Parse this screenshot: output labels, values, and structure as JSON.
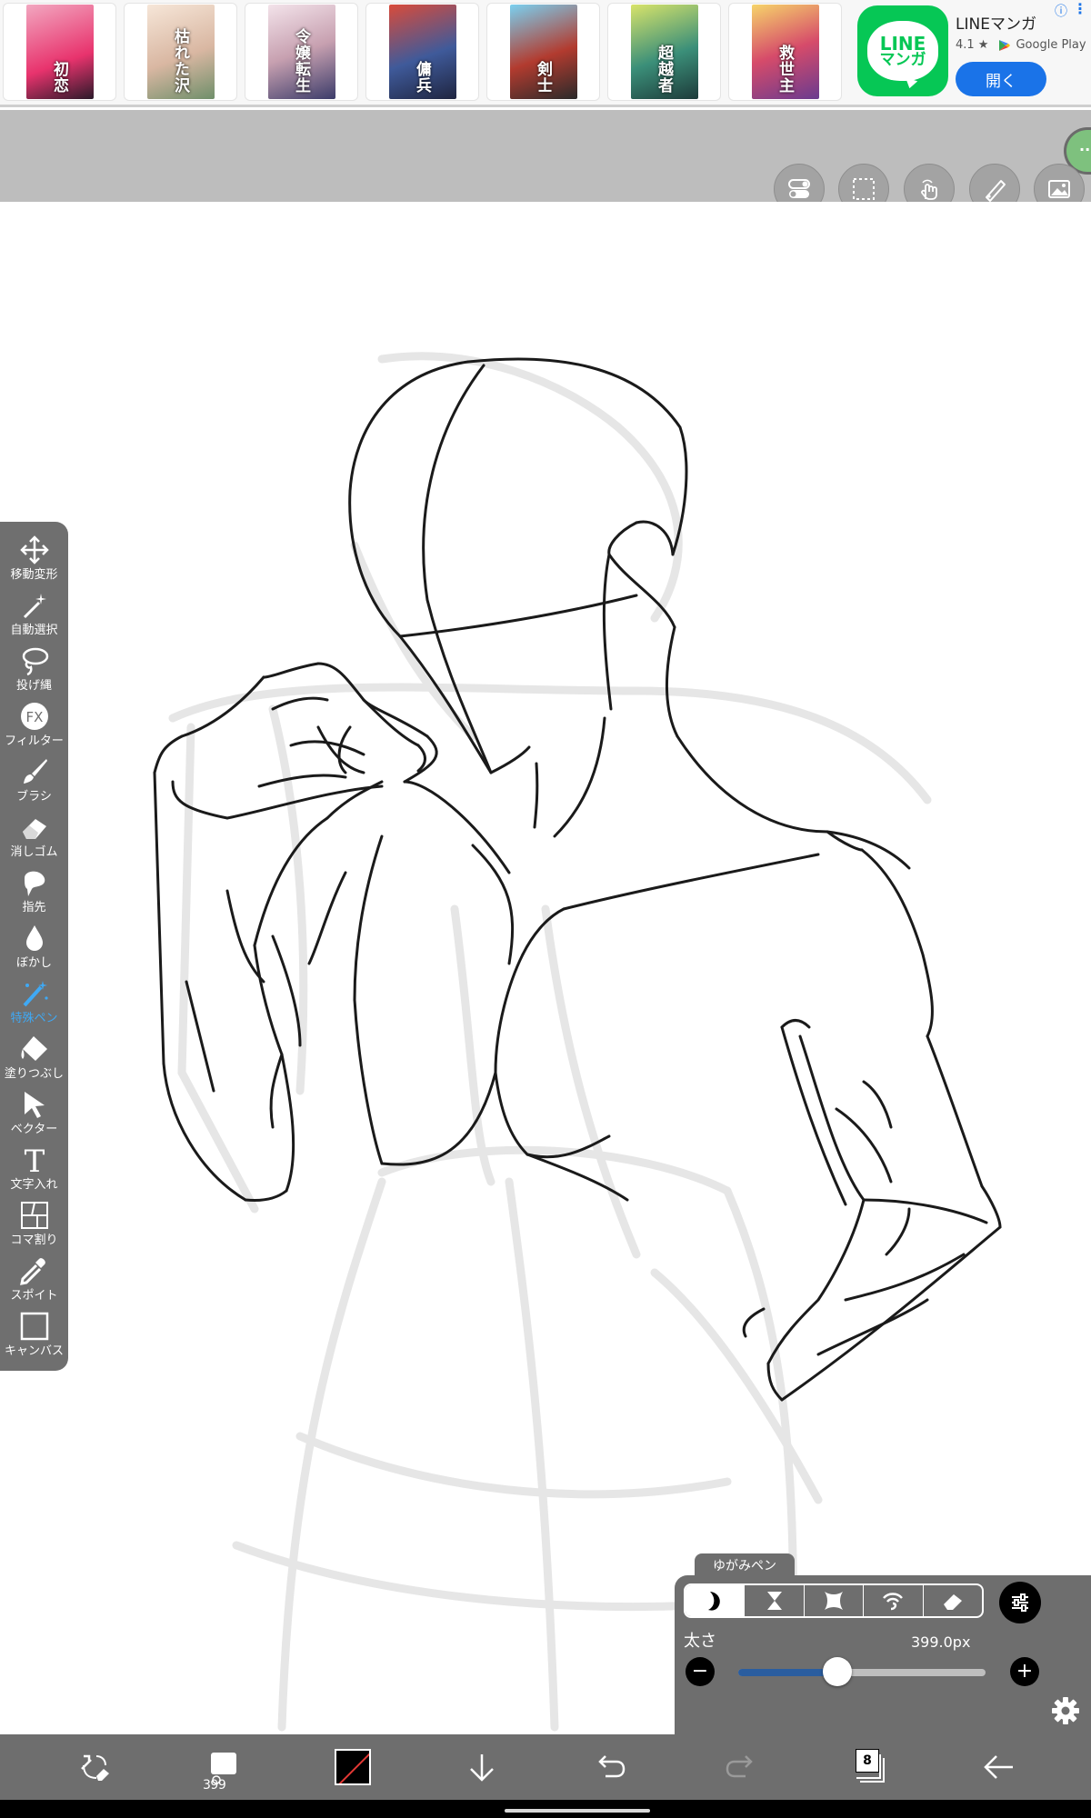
{
  "ad": {
    "thumbnails": [
      {
        "title": "初恋",
        "color": "#e8336d"
      },
      {
        "title": "枯れた沢",
        "color": "#d9b7a2"
      },
      {
        "title": "令嬢転生",
        "color": "#c7a0b0"
      },
      {
        "title": "傭兵",
        "color": "#3f5a9a"
      },
      {
        "title": "剣士",
        "color": "#b23b2f"
      },
      {
        "title": "超越者",
        "color": "#3b8f79"
      },
      {
        "title": "救世主",
        "color": "#d64b6a"
      }
    ],
    "app_name": "LINEマンガ",
    "logo_line1": "LINE",
    "logo_line2": "マンガ",
    "rating": "4.1 ★",
    "store": "Google Play",
    "open_label": "開く",
    "info_icon": "ⓘ",
    "more_icon": "⋮"
  },
  "side_tab": {
    "label": "··"
  },
  "tools": [
    {
      "label": "移動変形",
      "icon": "move-icon"
    },
    {
      "label": "自動選択",
      "icon": "magic-wand-icon"
    },
    {
      "label": "投げ縄",
      "icon": "lasso-icon"
    },
    {
      "label": "フィルター",
      "icon": "fx-icon"
    },
    {
      "label": "ブラシ",
      "icon": "brush-icon"
    },
    {
      "label": "消しゴム",
      "icon": "eraser-icon"
    },
    {
      "label": "指先",
      "icon": "finger-icon"
    },
    {
      "label": "ぼかし",
      "icon": "blur-icon"
    },
    {
      "label": "特殊ペン",
      "icon": "special-pen-icon",
      "active": true
    },
    {
      "label": "塗りつぶし",
      "icon": "fill-icon"
    },
    {
      "label": "ベクター",
      "icon": "vector-icon"
    },
    {
      "label": "文字入れ",
      "icon": "text-icon"
    },
    {
      "label": "コマ割り",
      "icon": "panel-icon"
    },
    {
      "label": "スポイト",
      "icon": "eyedropper-icon"
    },
    {
      "label": "キャンバス",
      "icon": "canvas-icon"
    }
  ],
  "fx_text": "FX",
  "text_tool_glyph": "T",
  "brush_panel": {
    "pen_name": "ゆがみペン",
    "thickness_label": "太さ",
    "thickness_value": "399.0px",
    "thickness_fraction": 0.4,
    "minus": "−",
    "plus": "+"
  },
  "bottom_bar": {
    "brush_size": "399",
    "layer_count": "8",
    "color": "#000000"
  }
}
